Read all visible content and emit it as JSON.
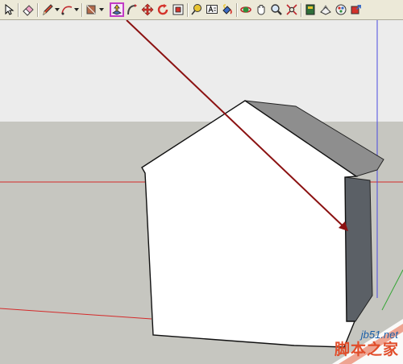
{
  "toolbar": {
    "tools": [
      {
        "name": "select-tool-button",
        "icon": "arrow-cursor-icon"
      },
      {
        "name": "eraser-tool-button",
        "icon": "eraser-icon"
      },
      {
        "name": "pencil-line-tool-button",
        "icon": "pencil-icon"
      },
      {
        "name": "arc-tool-button",
        "icon": "arc-icon"
      },
      {
        "name": "paint-bucket-tool-button",
        "icon": "paint-bucket-icon"
      },
      {
        "name": "push-pull-tool-button",
        "icon": "push-pull-icon",
        "active": true
      },
      {
        "name": "follow-me-tool-button",
        "icon": "follow-me-icon"
      },
      {
        "name": "move-tool-button",
        "icon": "move-arrows-icon"
      },
      {
        "name": "rotate-tool-button",
        "icon": "rotate-icon"
      },
      {
        "name": "offset-tool-button",
        "icon": "offset-icon"
      },
      {
        "name": "tape-measure-tool-button",
        "icon": "tape-measure-icon"
      },
      {
        "name": "text-tool-button",
        "icon": "text-icon"
      },
      {
        "name": "paint-tool-button",
        "icon": "paint-icon"
      },
      {
        "name": "orbit-tool-button",
        "icon": "orbit-icon"
      },
      {
        "name": "pan-tool-button",
        "icon": "pan-hand-icon"
      },
      {
        "name": "zoom-tool-button",
        "icon": "zoom-icon"
      },
      {
        "name": "zoom-extents-tool-button",
        "icon": "zoom-extents-icon"
      },
      {
        "name": "component-browser-button",
        "icon": "component-book-icon"
      },
      {
        "name": "styles-button",
        "icon": "styles-icon"
      },
      {
        "name": "materials-button",
        "icon": "materials-icon"
      },
      {
        "name": "share-model-button",
        "icon": "share-icon"
      }
    ],
    "active_tool": "push-pull",
    "active_color": "#c23bc6"
  },
  "scene": {
    "sky_color": "#ececec",
    "ground_color": "#c6c6c0",
    "red_axis_color": "#d42a2a",
    "green_axis_color": "#35a535",
    "blue_axis_color": "#4a4ae0",
    "arrow_color": "#8b1111",
    "front_face_color": "#ffffff",
    "roof_color": "#8e8e8e",
    "side_face_color": "#5b6066"
  },
  "watermark": {
    "site": "jb51.net",
    "name": "脚本之家"
  }
}
